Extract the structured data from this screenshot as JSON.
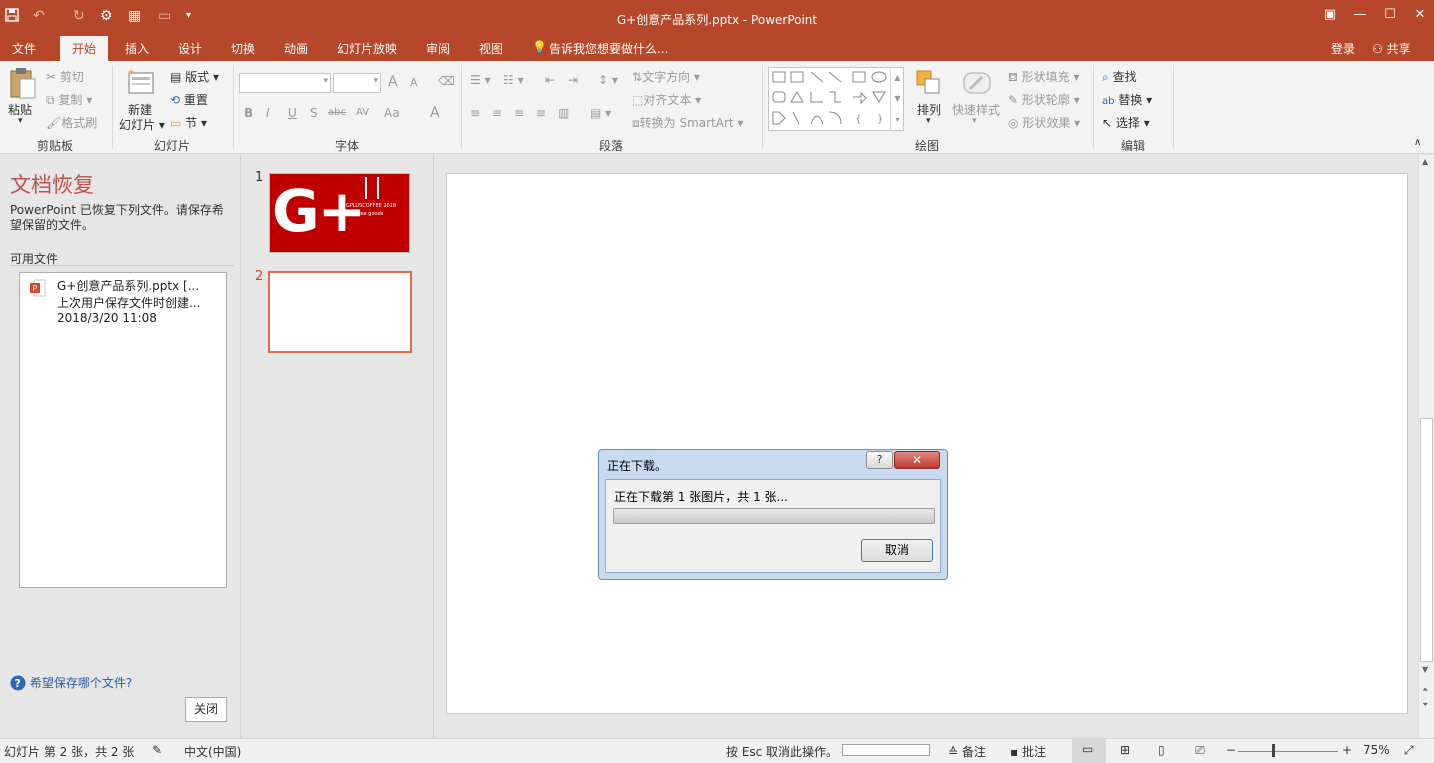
{
  "window": {
    "title": "G+创意产品系列.pptx - PowerPoint"
  },
  "tabs": {
    "file": "文件",
    "home": "开始",
    "insert": "插入",
    "design": "设计",
    "transitions": "切换",
    "animations": "动画",
    "slideshow": "幻灯片放映",
    "review": "审阅",
    "view": "视图",
    "tell_me": "告诉我您想要做什么...",
    "login": "登录",
    "share": "共享"
  },
  "ribbon": {
    "clipboard": {
      "label": "剪贴板",
      "paste": "粘贴",
      "cut": "剪切",
      "copy": "复制",
      "format_painter": "格式刷"
    },
    "slides": {
      "label": "幻灯片",
      "new_slide": "新建",
      "new_slide2": "幻灯片",
      "layout": "版式",
      "reset": "重置",
      "section": "节"
    },
    "font": {
      "label": "字体",
      "bold": "B",
      "italic": "I",
      "underline": "U",
      "shadow": "S",
      "strike": "abc",
      "spacing": "AV",
      "case": "Aa",
      "color": "A",
      "grow": "A",
      "shrink": "A"
    },
    "paragraph": {
      "label": "段落",
      "text_direction": "文字方向",
      "align_text": "对齐文本",
      "smartart": "转换为 SmartArt"
    },
    "drawing": {
      "label": "绘图",
      "arrange": "排列",
      "quick_styles": "快速样式",
      "shape_fill": "形状填充",
      "shape_outline": "形状轮廓",
      "shape_effects": "形状效果"
    },
    "editing": {
      "label": "编辑",
      "find": "查找",
      "replace": "替换",
      "select": "选择"
    }
  },
  "recovery": {
    "title": "文档恢复",
    "description": "PowerPoint 已恢复下列文件。请保存希望保留的文件。",
    "available_label": "可用文件",
    "file": {
      "name": "G+创意产品系列.pptx  [...",
      "note": "上次用户保存文件时创建...",
      "date": "2018/3/20 11:08"
    },
    "help_link": "希望保存哪个文件?",
    "close_button": "关闭"
  },
  "thumbnails": {
    "slide1_num": "1",
    "slide2_num": "2",
    "slide1_logo": "G+",
    "slide1_line1": "GPLUSCOFFEE 2018",
    "slide1_line2": "idea goods"
  },
  "dialog": {
    "title": "正在下载。",
    "message": "正在下载第 1 张图片，共 1 张...",
    "help": "?",
    "close": "✕",
    "cancel": "取消",
    "progress": 0.0
  },
  "statusbar": {
    "slide_info": "幻灯片 第 2 张，共 2 张",
    "language": "中文(中国)",
    "esc_hint": "按 Esc 取消此操作。",
    "notes": "备注",
    "comments": "批注",
    "zoom": "75%"
  }
}
